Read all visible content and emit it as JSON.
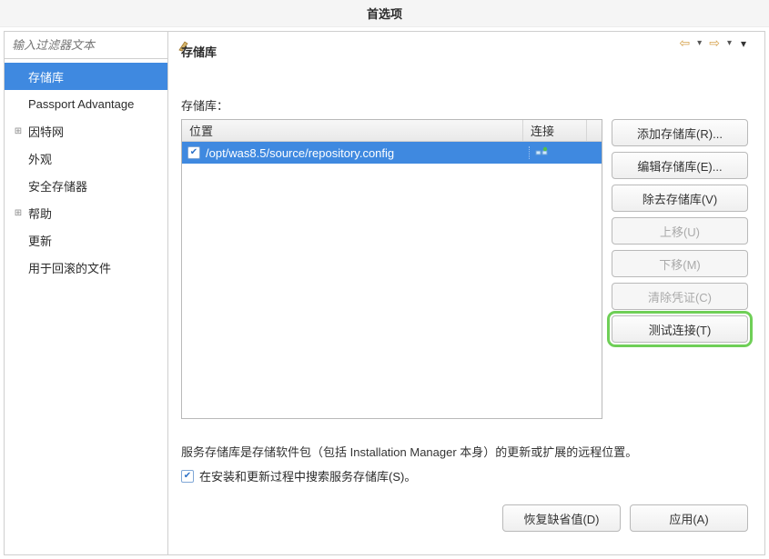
{
  "window": {
    "title": "首选项"
  },
  "sidebar": {
    "filter_placeholder": "输入过滤器文本",
    "items": [
      {
        "label": "存储库",
        "selected": true,
        "expander": ""
      },
      {
        "label": "Passport Advantage",
        "selected": false,
        "expander": ""
      },
      {
        "label": "因特网",
        "selected": false,
        "expander": "⊞"
      },
      {
        "label": "外观",
        "selected": false,
        "expander": ""
      },
      {
        "label": "安全存储器",
        "selected": false,
        "expander": ""
      },
      {
        "label": "帮助",
        "selected": false,
        "expander": "⊞"
      },
      {
        "label": "更新",
        "selected": false,
        "expander": ""
      },
      {
        "label": "用于回滚的文件",
        "selected": false,
        "expander": ""
      }
    ]
  },
  "content": {
    "heading": "存储库",
    "list_label": "存储库：",
    "columns": {
      "location": "位置",
      "connection": "连接"
    },
    "rows": [
      {
        "checked": true,
        "path": "/opt/was8.5/source/repository.config",
        "connected": true
      }
    ],
    "buttons": {
      "add": "添加存储库(R)...",
      "edit": "编辑存储库(E)...",
      "remove": "除去存储库(V)",
      "up": "上移(U)",
      "down": "下移(M)",
      "clear_creds": "清除凭证(C)",
      "test_conn": "测试连接(T)"
    },
    "description": "服务存储库是存储软件包（包括 Installation Manager 本身）的更新或扩展的远程位置。",
    "search_checkbox": {
      "checked": true,
      "label": "在安装和更新过程中搜索服务存储库(S)。"
    }
  },
  "footer": {
    "restore_defaults": "恢复缺省值(D)",
    "apply": "应用(A)"
  }
}
